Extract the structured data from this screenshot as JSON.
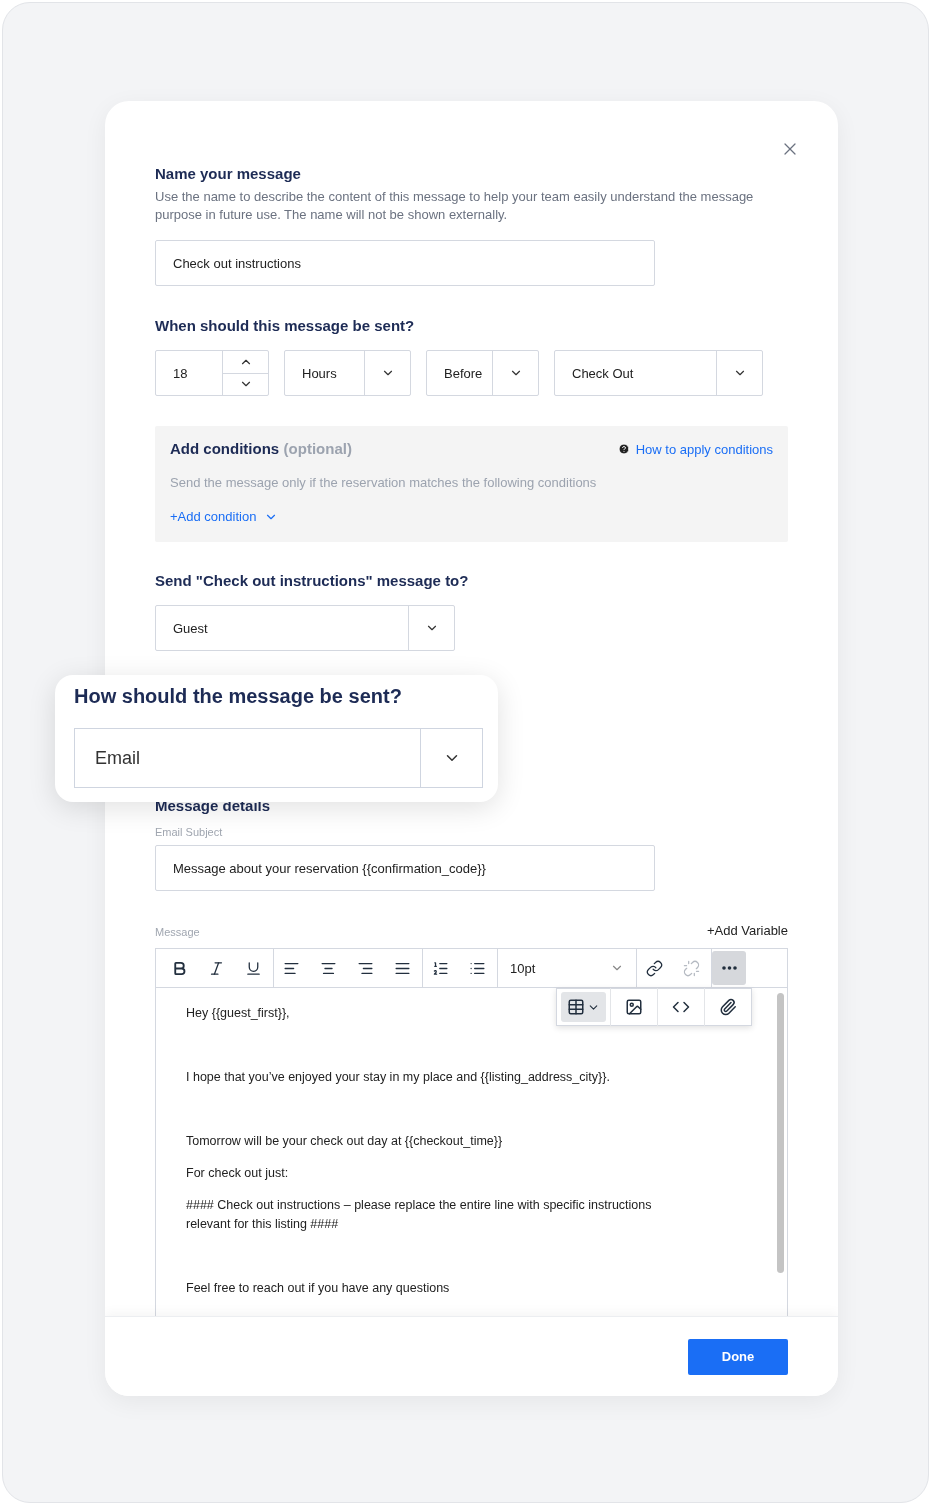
{
  "name_section": {
    "title": "Name your message",
    "description": "Use the name to describe the content of this message to help your team easily understand the message purpose in future use. The name will not be shown externally.",
    "value": "Check out instructions"
  },
  "timing": {
    "title": "When should this message be sent?",
    "amount": "18",
    "unit": "Hours",
    "relation": "Before",
    "event": "Check Out"
  },
  "conditions": {
    "title": "Add conditions",
    "optional": "(optional)",
    "help_link": "How to apply conditions",
    "description": "Send the message only if the reservation matches the following conditions",
    "add_button": "+Add condition"
  },
  "recipient": {
    "title": "Send \"Check out instructions\" message to?",
    "value": "Guest"
  },
  "channel_popup": {
    "title": "How should the message be sent?",
    "value": "Email"
  },
  "details": {
    "title": "Message details",
    "subject_label": "Email Subject",
    "subject_value": "Message about your reservation {{confirmation_code}}",
    "message_label": "Message",
    "add_variable": "+Add Variable",
    "toolbar": [
      {
        "kind": "bold",
        "selected": false
      },
      {
        "kind": "italic",
        "selected": false
      },
      {
        "kind": "underline",
        "selected": false
      },
      {
        "kind": "divider"
      },
      {
        "kind": "align-left",
        "selected": false
      },
      {
        "kind": "align-center",
        "selected": false
      },
      {
        "kind": "align-right",
        "selected": false
      },
      {
        "kind": "align-justify",
        "selected": false
      },
      {
        "kind": "divider"
      },
      {
        "kind": "ordered-list",
        "selected": false
      },
      {
        "kind": "bullet-list",
        "selected": false
      },
      {
        "kind": "divider"
      },
      {
        "kind": "font-size",
        "value": "10pt"
      },
      {
        "kind": "divider"
      },
      {
        "kind": "link",
        "selected": false
      },
      {
        "kind": "unlink",
        "selected": false,
        "disabled": true
      },
      {
        "kind": "divider"
      },
      {
        "kind": "more",
        "selected": true
      }
    ],
    "more_menu": [
      {
        "kind": "table",
        "selected": true
      },
      {
        "kind": "image",
        "selected": false
      },
      {
        "kind": "code",
        "selected": false
      },
      {
        "kind": "attachment",
        "selected": false
      }
    ],
    "body": [
      [
        "Hey {{guest_first}},"
      ],
      [
        "I hope that you’ve enjoyed your stay in my place and {{listing_address_city}}."
      ],
      [
        "Tomorrow will be your check out day at {{checkout_time}}",
        "For check out just:",
        "#### Check out instructions – please replace the entire line with specific instructions relevant for this listing ####"
      ],
      [
        "Feel free to reach out if you have any questions"
      ]
    ]
  },
  "done_button": "Done"
}
